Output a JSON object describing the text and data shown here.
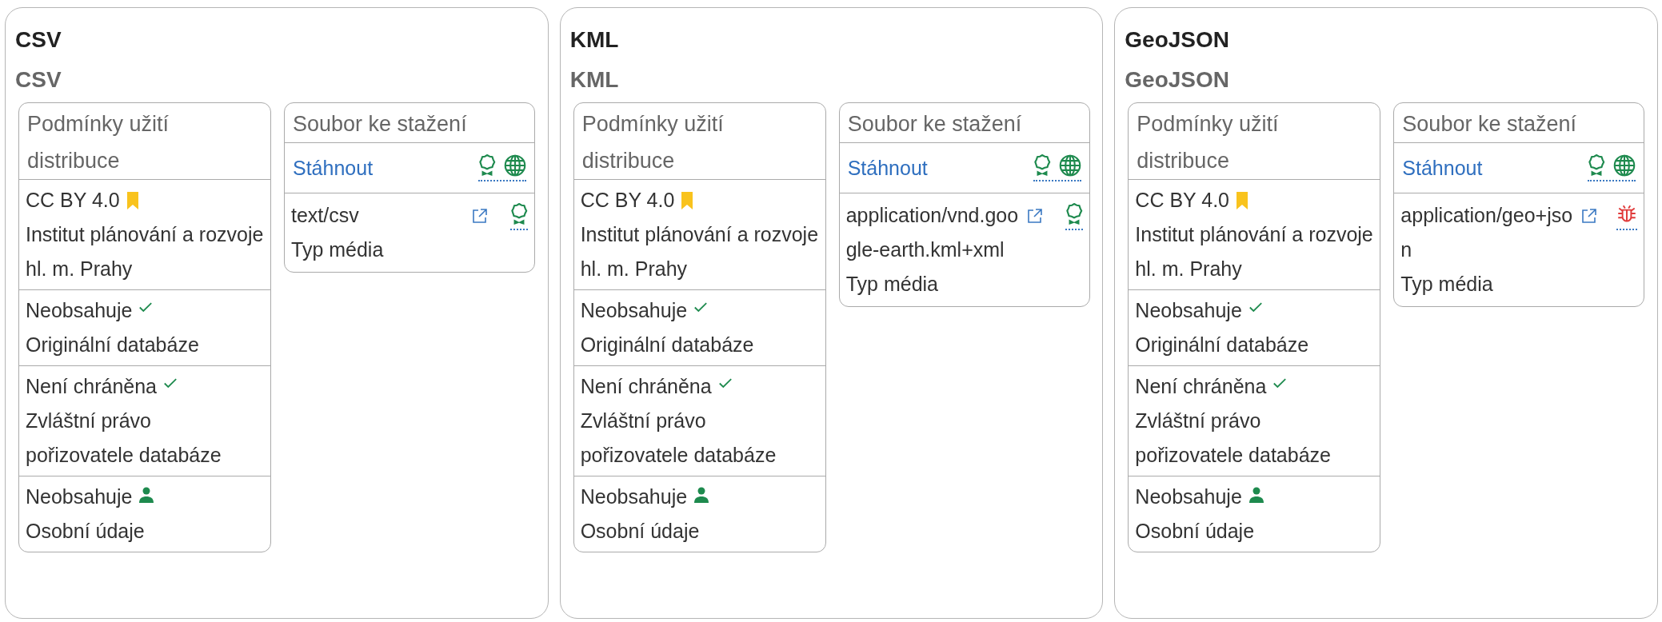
{
  "cards": [
    {
      "title": "CSV",
      "subtitle": "CSV",
      "terms": {
        "header": "Podmínky užití distribuce",
        "rows": [
          {
            "value": "CC BY 4.0",
            "kind": "bookmark",
            "label": "Institut plánování a rozvoje hl. m. Prahy"
          },
          {
            "value": "Neobsahuje",
            "kind": "check",
            "label": "Originální databáze"
          },
          {
            "value": "Není chráněna",
            "kind": "check",
            "label": "Zvláštní právo pořizovatele databáze"
          },
          {
            "value": "Neobsahuje",
            "kind": "person",
            "label": "Osobní údaje"
          }
        ]
      },
      "file": {
        "header": "Soubor ke stažení",
        "download": "Stáhnout",
        "media": {
          "type": "text/csv",
          "label": "Typ média",
          "kind": "award"
        }
      }
    },
    {
      "title": "KML",
      "subtitle": "KML",
      "terms": {
        "header": "Podmínky užití distribuce",
        "rows": [
          {
            "value": "CC BY 4.0",
            "kind": "bookmark",
            "label": "Institut plánování a rozvoje hl. m. Prahy"
          },
          {
            "value": "Neobsahuje",
            "kind": "check",
            "label": "Originální databáze"
          },
          {
            "value": "Není chráněna",
            "kind": "check",
            "label": "Zvláštní právo pořizovatele databáze"
          },
          {
            "value": "Neobsahuje",
            "kind": "person",
            "label": "Osobní údaje"
          }
        ]
      },
      "file": {
        "header": "Soubor ke stažení",
        "download": "Stáhnout",
        "media": {
          "type": "application/vnd.google-earth.kml+xml",
          "label": "Typ média",
          "kind": "award"
        }
      }
    },
    {
      "title": "GeoJSON",
      "subtitle": "GeoJSON",
      "terms": {
        "header": "Podmínky užití distribuce",
        "rows": [
          {
            "value": "CC BY 4.0",
            "kind": "bookmark",
            "label": "Institut plánování a rozvoje hl. m. Prahy"
          },
          {
            "value": "Neobsahuje",
            "kind": "check",
            "label": "Originální databáze"
          },
          {
            "value": "Není chráněna",
            "kind": "check",
            "label": "Zvláštní právo pořizovatele databáze"
          },
          {
            "value": "Neobsahuje",
            "kind": "person",
            "label": "Osobní údaje"
          }
        ]
      },
      "file": {
        "header": "Soubor ke stažení",
        "download": "Stáhnout",
        "media": {
          "type": "application/geo+json",
          "label": "Typ média",
          "kind": "bug"
        }
      }
    }
  ]
}
